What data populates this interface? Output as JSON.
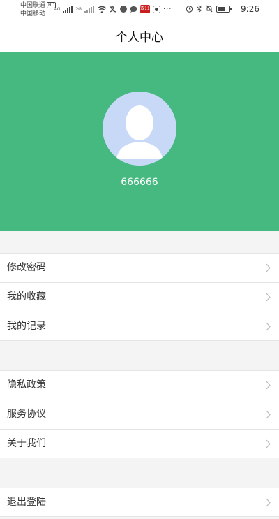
{
  "status_bar": {
    "carrier_1": "中国联通",
    "hd_badge": "HD",
    "carrier_2": "中国移动",
    "net_4g": "4G",
    "net_2g": "2G",
    "app_badge": "双11",
    "more": "···",
    "time": "9:26",
    "battery_level": 0.6
  },
  "nav": {
    "title": "个人中心"
  },
  "profile": {
    "username": "666666",
    "header_color": "#45b980"
  },
  "menu": {
    "group1": [
      {
        "label": "修改密码"
      },
      {
        "label": "我的收藏"
      },
      {
        "label": "我的记录"
      }
    ],
    "group2": [
      {
        "label": "隐私政策"
      },
      {
        "label": "服务协议"
      },
      {
        "label": "关于我们"
      }
    ],
    "group3": [
      {
        "label": "退出登陆"
      }
    ]
  }
}
